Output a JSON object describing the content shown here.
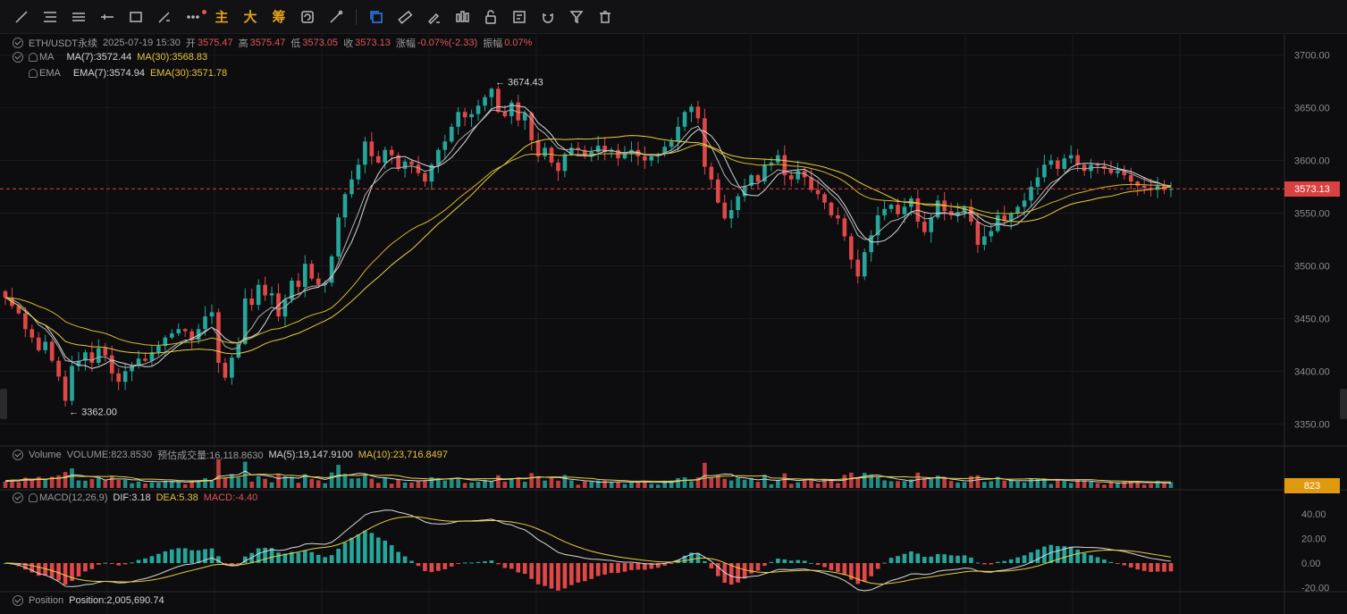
{
  "toolbar": {
    "items": [
      "trend-line",
      "horizontal-lines",
      "parallel-channel",
      "horizontal-ray",
      "rectangle",
      "brush",
      "more"
    ],
    "text_buttons": [
      "主",
      "大",
      "筹"
    ],
    "right_items": [
      "replay",
      "measure",
      "price-range",
      "long-position",
      "bar-pattern",
      "lock",
      "note",
      "magnet",
      "filter",
      "delete"
    ]
  },
  "header": {
    "symbol": "ETH/USDT永续",
    "datetime": "2025-07-19 15:30",
    "open_label": "开",
    "open": "3575.47",
    "high_label": "高",
    "high": "3575.47",
    "low_label": "低",
    "low": "3573.05",
    "close_label": "收",
    "close": "3573.13",
    "change_label": "涨幅",
    "change": "-0.07%(-2.33)",
    "amp_label": "振幅",
    "amp": "0.07%"
  },
  "ma": {
    "label": "MA",
    "ma7": "MA(7):3572.44",
    "ma30": "MA(30):3568.83"
  },
  "ema": {
    "label": "EMA",
    "ema7": "EMA(7):3574.94",
    "ema30": "EMA(30):3571.78"
  },
  "annotations": {
    "high": "3674.43",
    "low": "3362.00"
  },
  "volume": {
    "label": "Volume",
    "vol": "VOLUME:823.8530",
    "est_label": "预估成交量:16,118.8630",
    "ma5": "MA(5):19,147.9100",
    "ma10": "MA(10):23,716.8497",
    "tag": "823"
  },
  "macd": {
    "label": "MACD(12,26,9)",
    "dif": "DIF:3.18",
    "dea": "DEA:5.38",
    "macd": "MACD:-4.40"
  },
  "position": {
    "label": "Position",
    "value": "Position:2,005,690.74"
  },
  "price_axis": [
    "3700.00",
    "3650.00",
    "3600.00",
    "3550.00",
    "3500.00",
    "3450.00",
    "3400.00",
    "3350.00"
  ],
  "macd_axis": [
    "40.00",
    "20.00",
    "0.00",
    "-20.00"
  ],
  "current_price": "3573.13",
  "colors": {
    "up": "#26a69a",
    "down": "#e04848",
    "ma_white": "#d8d8d8",
    "ma_yellow": "#e8d040",
    "accent": "#2f7df6",
    "vol_tag": "#e09a10"
  },
  "chart_data": {
    "type": "candlestick",
    "y_range": [
      3330,
      3720
    ],
    "closes": [
      3470,
      3462,
      3455,
      3440,
      3432,
      3420,
      3428,
      3410,
      3395,
      3372,
      3405,
      3410,
      3418,
      3408,
      3422,
      3415,
      3398,
      3390,
      3400,
      3405,
      3412,
      3410,
      3418,
      3424,
      3432,
      3436,
      3440,
      3438,
      3430,
      3440,
      3452,
      3456,
      3408,
      3394,
      3413,
      3426,
      3469,
      3463,
      3482,
      3472,
      3474,
      3452,
      3468,
      3486,
      3480,
      3502,
      3488,
      3482,
      3484,
      3509,
      3546,
      3568,
      3582,
      3596,
      3618,
      3604,
      3598,
      3610,
      3605,
      3592,
      3599,
      3596,
      3588,
      3580,
      3596,
      3610,
      3618,
      3632,
      3646,
      3641,
      3644,
      3652,
      3660,
      3668,
      3646,
      3642,
      3655,
      3638,
      3645,
      3619,
      3604,
      3612,
      3598,
      3590,
      3606,
      3612,
      3610,
      3604,
      3608,
      3614,
      3608,
      3610,
      3602,
      3606,
      3610,
      3604,
      3600,
      3604,
      3606,
      3613,
      3618,
      3632,
      3646,
      3651,
      3640,
      3594,
      3582,
      3560,
      3545,
      3553,
      3566,
      3576,
      3586,
      3580,
      3596,
      3598,
      3605,
      3586,
      3582,
      3590,
      3584,
      3572,
      3568,
      3560,
      3548,
      3545,
      3528,
      3506,
      3490,
      3513,
      3529,
      3548,
      3554,
      3558,
      3549,
      3556,
      3564,
      3542,
      3532,
      3546,
      3562,
      3552,
      3548,
      3551,
      3556,
      3542,
      3520,
      3528,
      3533,
      3548,
      3543,
      3550,
      3556,
      3562,
      3575,
      3584,
      3596,
      3600,
      3592,
      3602,
      3605,
      3596,
      3590,
      3596,
      3595,
      3592,
      3588,
      3590,
      3586,
      3580,
      3576,
      3574,
      3572,
      3576,
      3572,
      3573
    ],
    "high_annotation": 3674.43,
    "low_annotation": 3362.0,
    "current": 3573.13
  }
}
